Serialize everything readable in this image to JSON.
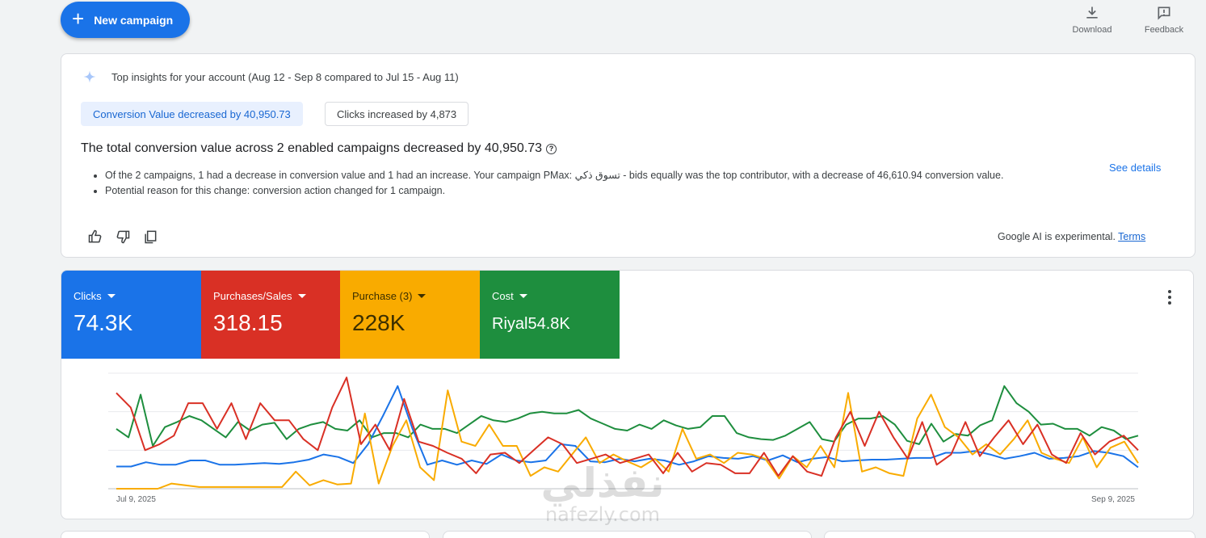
{
  "toolbar": {
    "new_campaign_label": "New campaign",
    "download_label": "Download",
    "feedback_label": "Feedback"
  },
  "insights": {
    "title": "Top insights for your account (Aug 12 - Sep 8 compared to Jul 15 - Aug 11)",
    "chip_active": "Conversion Value decreased by 40,950.73",
    "chip_other": "Clicks increased by 4,873",
    "headline": "The total conversion value across 2 enabled campaigns decreased by 40,950.73",
    "bullet_1": "Of the 2 campaigns, 1 had a decrease in conversion value and 1 had an increase. Your campaign PMax: تسوق ذكي - bids equally was the top contributor, with a decrease of 46,610.94 conversion value.",
    "bullet_2": "Potential reason for this change: conversion action changed for 1 campaign.",
    "see_details": "See details",
    "ai_note": "Google AI is experimental.",
    "terms": "Terms"
  },
  "metrics": [
    {
      "label": "Clicks",
      "value": "74.3K",
      "color": "#1a73e8"
    },
    {
      "label": "Purchases/Sales",
      "value": "318.15",
      "color": "#d93025"
    },
    {
      "label": "Purchase (3)",
      "value": "228K",
      "color": "#f9ab00"
    },
    {
      "label": "Cost",
      "value": "Riyal54.8K",
      "color": "#1e8e3e"
    }
  ],
  "chart_data": {
    "type": "line",
    "x_start_label": "Jul 9, 2025",
    "x_end_label": "Sep 9, 2025",
    "grid": true,
    "series": [
      {
        "name": "Clicks",
        "color": "#1a73e8",
        "values": [
          26,
          26,
          31,
          28,
          28,
          33,
          33,
          28,
          28,
          29,
          30,
          29,
          31,
          34,
          40,
          37,
          30,
          52,
          85,
          120,
          70,
          28,
          33,
          28,
          33,
          29,
          40,
          33,
          31,
          33,
          52,
          50,
          32,
          31,
          35,
          32,
          35,
          33,
          28,
          32,
          38,
          36,
          35,
          38,
          33,
          39,
          31,
          35,
          37,
          32,
          33,
          34,
          34,
          35,
          36,
          36,
          42,
          42,
          44,
          40,
          35,
          38,
          42,
          35,
          36,
          38,
          44,
          42,
          38,
          25
        ]
      },
      {
        "name": "Purchases/Sales",
        "color": "#d93025",
        "values": [
          112,
          95,
          45,
          52,
          62,
          100,
          100,
          70,
          100,
          58,
          100,
          80,
          80,
          58,
          45,
          95,
          130,
          52,
          75,
          45,
          105,
          55,
          50,
          42,
          35,
          18,
          40,
          42,
          30,
          45,
          60,
          52,
          30,
          35,
          40,
          30,
          35,
          40,
          18,
          42,
          20,
          30,
          28,
          18,
          18,
          42,
          15,
          38,
          20,
          15,
          60,
          90,
          50,
          90,
          60,
          35,
          78,
          28,
          40,
          78,
          38,
          60,
          80,
          52,
          75,
          40,
          30,
          65,
          40,
          55,
          62,
          45
        ]
      },
      {
        "name": "Purchase (3)",
        "color": "#f9ab00",
        "values": [
          0,
          0,
          0,
          0,
          6,
          4,
          2,
          2,
          2,
          2,
          2,
          2,
          2,
          20,
          4,
          10,
          5,
          6,
          88,
          6,
          50,
          80,
          25,
          10,
          115,
          55,
          50,
          75,
          50,
          50,
          15,
          25,
          20,
          40,
          60,
          30,
          40,
          32,
          25,
          35,
          20,
          70,
          35,
          40,
          30,
          42,
          40,
          35,
          12,
          38,
          25,
          50,
          25,
          112,
          20,
          25,
          18,
          15,
          82,
          110,
          72,
          60,
          40,
          52,
          40,
          58,
          80,
          42,
          35,
          30,
          60,
          25,
          48,
          55,
          30
        ]
      },
      {
        "name": "Cost",
        "color": "#1e8e3e",
        "values": [
          70,
          60,
          110,
          50,
          72,
          78,
          85,
          80,
          70,
          60,
          78,
          68,
          75,
          77,
          58,
          70,
          75,
          78,
          70,
          68,
          80,
          60,
          65,
          65,
          60,
          75,
          70,
          70,
          65,
          75,
          85,
          80,
          78,
          82,
          88,
          90,
          88,
          88,
          92,
          82,
          76,
          70,
          68,
          75,
          70,
          80,
          74,
          70,
          72,
          85,
          85,
          65,
          60,
          58,
          57,
          62,
          70,
          78,
          58,
          55,
          75,
          82,
          82,
          85,
          75,
          56,
          52,
          76,
          55,
          64,
          62,
          74,
          80,
          120,
          100,
          90,
          75,
          76,
          70,
          70,
          62,
          72,
          68,
          58,
          62
        ]
      }
    ]
  },
  "watermark": {
    "arabic": "نفذلي",
    "latin": "nafezly.com"
  }
}
